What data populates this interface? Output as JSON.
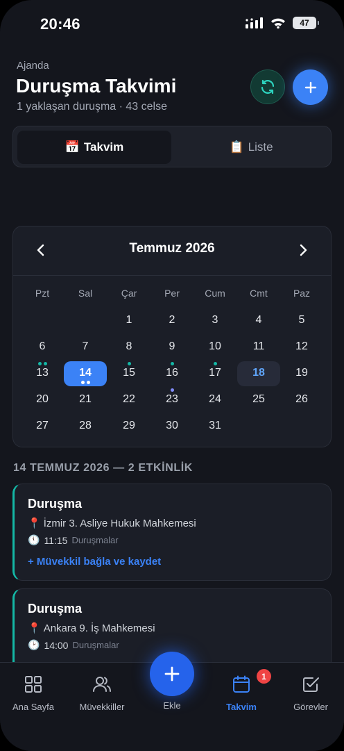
{
  "status_bar": {
    "time": "20:46",
    "battery": "47"
  },
  "header": {
    "eyebrow": "Ajanda",
    "title": "Duruşma Takvimi",
    "subtitle": "1 yaklaşan duruşma · 43 celse"
  },
  "segment": {
    "tabs": [
      {
        "icon": "📅",
        "label": "Takvim",
        "active": true
      },
      {
        "icon": "📋",
        "label": "Liste",
        "active": false
      }
    ]
  },
  "calendar": {
    "month_label": "Temmuz 2026",
    "weekdays": [
      "Pzt",
      "Sal",
      "Çar",
      "Per",
      "Cum",
      "Cmt",
      "Paz"
    ],
    "first_weekday_index": 2,
    "days_in_month": 31,
    "selected_day": 14,
    "today_day": 18,
    "event_dots": {
      "6": [
        "#14b8a6",
        "#14b8a6"
      ],
      "7": [
        "#14b8a6",
        "#14b8a6"
      ],
      "8": [
        "#14b8a6"
      ],
      "9": [
        "#14b8a6"
      ],
      "10": [
        "#14b8a6"
      ],
      "14": [
        "#ffffff",
        "#ffffff"
      ],
      "16": [
        "#818cf8"
      ]
    }
  },
  "section_title": "14 TEMMUZ 2026 — 2 ETKİNLİK",
  "events": [
    {
      "title": "Duruşma",
      "location_icon": "📍",
      "location": "İzmir 3. Asliye Hukuk Mahkemesi",
      "time_icon": "🕚",
      "time": "11:15",
      "tag": "Duruşmalar",
      "link": "+ Müvekkil bağla ve kaydet"
    },
    {
      "title": "Duruşma",
      "location_icon": "📍",
      "location": "Ankara 9. İş Mahkemesi",
      "time_icon": "🕑",
      "time": "14:00",
      "tag": "Duruşmalar"
    }
  ],
  "tabbar": {
    "items": [
      {
        "label": "Ana Sayfa",
        "icon": "grid-icon"
      },
      {
        "label": "Müvekkiller",
        "icon": "users-icon"
      },
      {
        "label": "Ekle",
        "icon": "plus-icon"
      },
      {
        "label": "Takvim",
        "icon": "calendar-icon",
        "badge": "1",
        "active": true
      },
      {
        "label": "Görevler",
        "icon": "checkbox-icon"
      }
    ]
  },
  "colors": {
    "accent": "#3b82f6",
    "teal": "#14b8a6",
    "badge": "#ef4444"
  }
}
